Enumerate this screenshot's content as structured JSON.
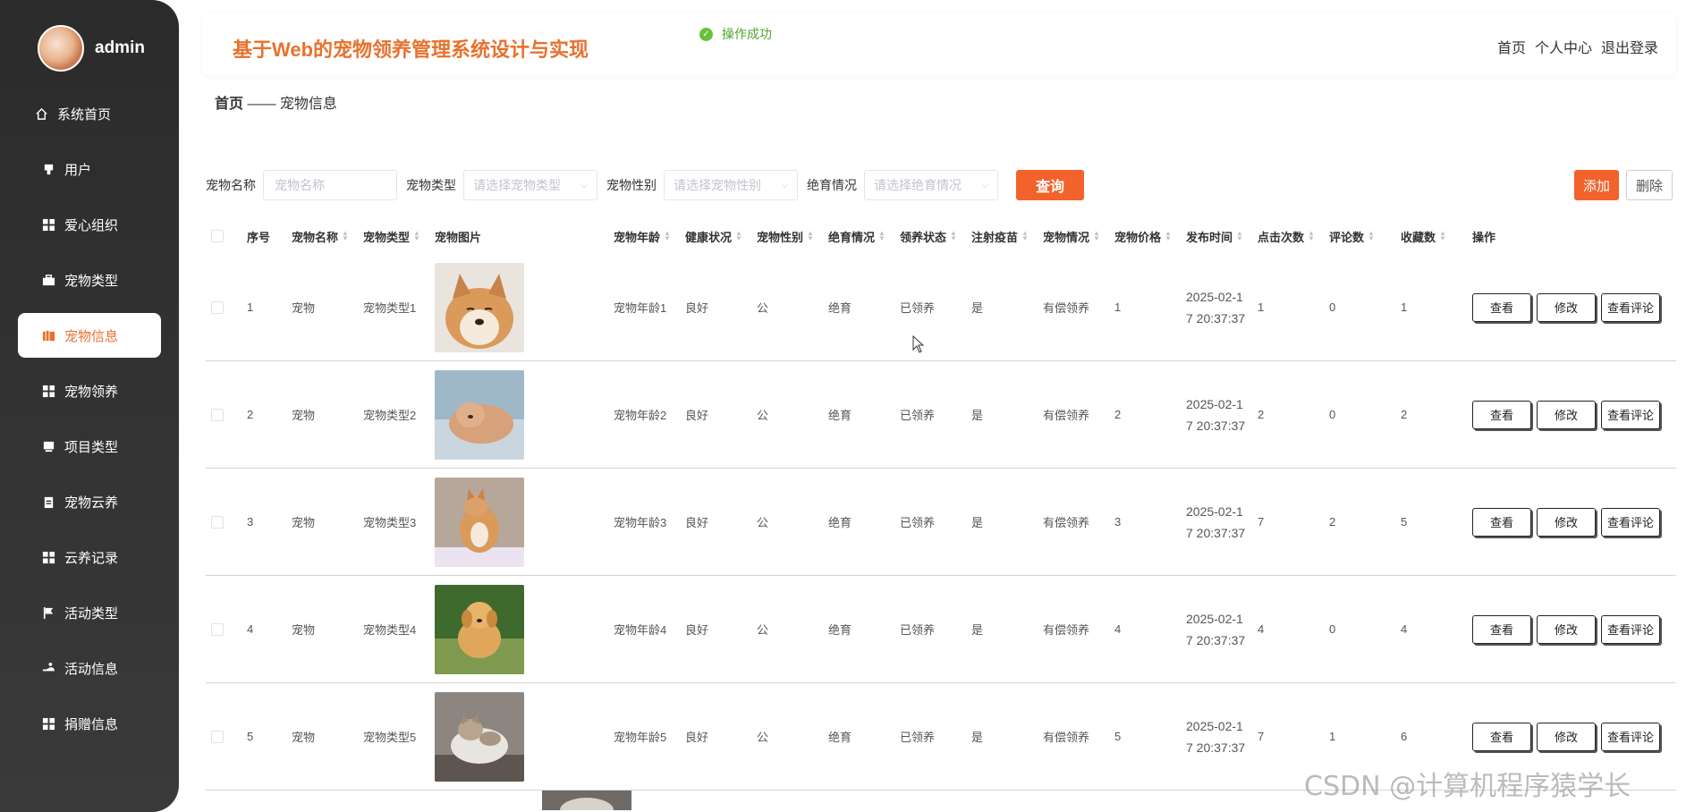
{
  "user": {
    "name": "admin"
  },
  "sidebar": {
    "items": [
      {
        "label": "系统首页",
        "icon": "home-icon",
        "active": false
      },
      {
        "label": "用户",
        "icon": "user-icon",
        "active": false
      },
      {
        "label": "爱心组织",
        "icon": "grid-icon",
        "active": false
      },
      {
        "label": "宠物类型",
        "icon": "briefcase-icon",
        "active": false
      },
      {
        "label": "宠物信息",
        "icon": "books-icon",
        "active": true
      },
      {
        "label": "宠物领养",
        "icon": "grid-icon",
        "active": false
      },
      {
        "label": "项目类型",
        "icon": "monitor-icon",
        "active": false
      },
      {
        "label": "宠物云养",
        "icon": "clipboard-icon",
        "active": false
      },
      {
        "label": "云养记录",
        "icon": "grid-icon",
        "active": false
      },
      {
        "label": "活动类型",
        "icon": "flag-icon",
        "active": false
      },
      {
        "label": "活动信息",
        "icon": "hand-icon",
        "active": false
      },
      {
        "label": "捐赠信息",
        "icon": "grid-icon",
        "active": false
      }
    ]
  },
  "header": {
    "title": "基于Web的宠物领养管理系统设计与实现",
    "toast": "操作成功",
    "links": [
      "首页",
      "个人中心",
      "退出登录"
    ]
  },
  "breadcrumb": {
    "home": "首页",
    "separator": "——",
    "current": "宠物信息"
  },
  "search": {
    "name_label": "宠物名称",
    "name_placeholder": "宠物名称",
    "type_label": "宠物类型",
    "type_placeholder": "请选择宠物类型",
    "sex_label": "宠物性别",
    "sex_placeholder": "请选择宠物性别",
    "ster_label": "绝育情况",
    "ster_placeholder": "请选择绝育情况",
    "query_button": "查询",
    "add_button": "添加",
    "delete_button": "删除"
  },
  "table": {
    "columns": [
      "序号",
      "宠物名称",
      "宠物类型",
      "宠物图片",
      "宠物年龄",
      "健康状况",
      "宠物性别",
      "绝育情况",
      "领养状态",
      "注射疫苗",
      "宠物情况",
      "宠物价格",
      "发布时间",
      "点击次数",
      "评论数",
      "收藏数",
      "操作"
    ],
    "rows": [
      {
        "no": "1",
        "name": "宠物",
        "type": "宠物类型1",
        "age": "宠物年龄1",
        "health": "良好",
        "sex": "公",
        "ster": "绝育",
        "adopt": "已领养",
        "vac": "是",
        "cond": "有偿领养",
        "price": "1",
        "time1": "2025-02-1",
        "time2": "7 20:37:37",
        "click": "1",
        "comm": "0",
        "fav": "1"
      },
      {
        "no": "2",
        "name": "宠物",
        "type": "宠物类型2",
        "age": "宠物年龄2",
        "health": "良好",
        "sex": "公",
        "ster": "绝育",
        "adopt": "已领养",
        "vac": "是",
        "cond": "有偿领养",
        "price": "2",
        "time1": "2025-02-1",
        "time2": "7 20:37:37",
        "click": "2",
        "comm": "0",
        "fav": "2"
      },
      {
        "no": "3",
        "name": "宠物",
        "type": "宠物类型3",
        "age": "宠物年龄3",
        "health": "良好",
        "sex": "公",
        "ster": "绝育",
        "adopt": "已领养",
        "vac": "是",
        "cond": "有偿领养",
        "price": "3",
        "time1": "2025-02-1",
        "time2": "7 20:37:37",
        "click": "7",
        "comm": "2",
        "fav": "5"
      },
      {
        "no": "4",
        "name": "宠物",
        "type": "宠物类型4",
        "age": "宠物年龄4",
        "health": "良好",
        "sex": "公",
        "ster": "绝育",
        "adopt": "已领养",
        "vac": "是",
        "cond": "有偿领养",
        "price": "4",
        "time1": "2025-02-1",
        "time2": "7 20:37:37",
        "click": "4",
        "comm": "0",
        "fav": "4"
      },
      {
        "no": "5",
        "name": "宠物",
        "type": "宠物类型5",
        "age": "宠物年龄5",
        "health": "良好",
        "sex": "公",
        "ster": "绝育",
        "adopt": "已领养",
        "vac": "是",
        "cond": "有偿领养",
        "price": "5",
        "time1": "2025-02-1",
        "time2": "7 20:37:37",
        "click": "7",
        "comm": "1",
        "fav": "6"
      }
    ],
    "actions": {
      "view": "查看",
      "edit": "修改",
      "comments": "查看评论"
    }
  },
  "watermark": "CSDN @计算机程序猿学长",
  "colors": {
    "accent": "#f2622b",
    "title": "#e8712d",
    "sidebar": "#2b2b2b"
  }
}
